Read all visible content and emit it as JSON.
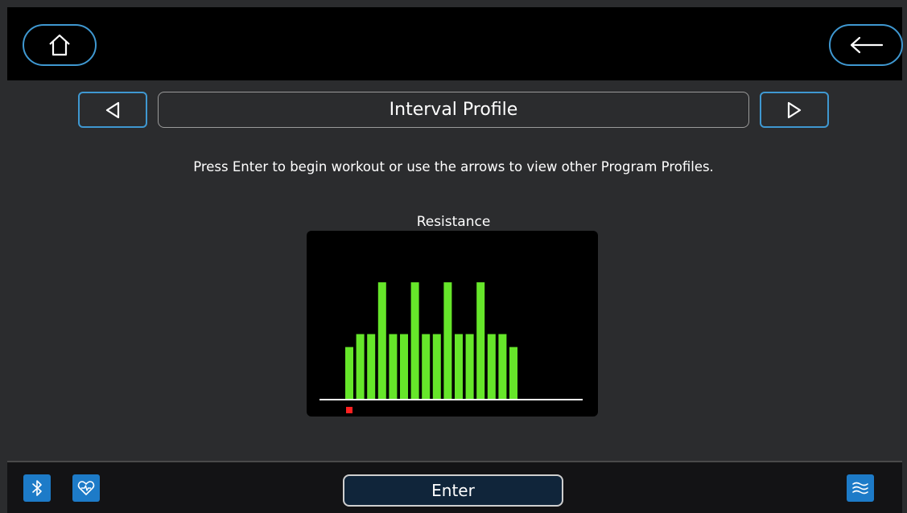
{
  "header": {
    "home_icon": "home-icon",
    "back_icon": "arrow-left-icon"
  },
  "profile": {
    "title": "Interval Profile",
    "prev_icon": "triangle-left-icon",
    "next_icon": "triangle-right-icon",
    "instructions": "Press Enter to begin workout or use the arrows to view other Program Profiles."
  },
  "chart_data": {
    "type": "bar",
    "title": "Resistance",
    "values": [
      4,
      5,
      5,
      9,
      5,
      5,
      9,
      5,
      5,
      9,
      5,
      5,
      9,
      5,
      5,
      4
    ],
    "ylim": [
      0,
      10
    ],
    "bar_color": "#66e62a",
    "current_segment": 1,
    "marker_color": "#ff2020"
  },
  "footer": {
    "enter_label": "Enter",
    "bluetooth_icon": "bluetooth-icon",
    "heart_rate_icon": "heart-rate-icon",
    "menu_icon": "wave-menu-icon"
  },
  "colors": {
    "accent": "#3f98d1",
    "button_fill": "#1d7bc8"
  }
}
